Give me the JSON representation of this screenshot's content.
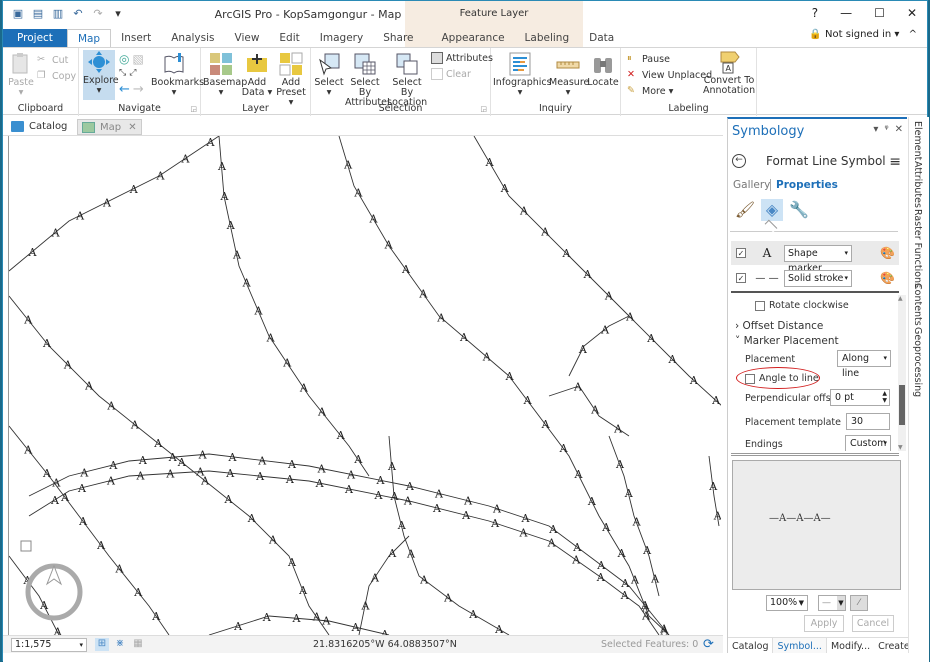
{
  "window": {
    "title": "ArcGIS Pro - KopSamgongur - Map",
    "context_tab_group": "Feature Layer",
    "help_label": "?",
    "minimize_label": "—",
    "maximize_label": "☐",
    "close_label": "✕",
    "sign_in_label": "Not signed in ▾",
    "collapse_ribbon_label": "^"
  },
  "quick_access": {
    "undo_label": "↶",
    "redo_label": "↷",
    "customize_label": "▾"
  },
  "ribbon_tabs": [
    {
      "label": "Project"
    },
    {
      "label": "Map"
    },
    {
      "label": "Insert"
    },
    {
      "label": "Analysis"
    },
    {
      "label": "View"
    },
    {
      "label": "Edit"
    },
    {
      "label": "Imagery"
    },
    {
      "label": "Share"
    },
    {
      "label": "Appearance"
    },
    {
      "label": "Labeling"
    },
    {
      "label": "Data"
    }
  ],
  "ribbon": {
    "clipboard": {
      "label": "Clipboard",
      "paste": "Paste",
      "cut": "Cut",
      "copy": "Copy"
    },
    "navigate": {
      "label": "Navigate",
      "explore": "Explore",
      "bookmarks": "Bookmarks"
    },
    "layer": {
      "label": "Layer",
      "basemap": "Basemap",
      "add_data_1": "Add",
      "add_data_2": "Data ▾",
      "add_preset_1": "Add",
      "add_preset_2": "Preset ▾"
    },
    "selection": {
      "label": "Selection",
      "select": "Select",
      "select_by_attributes_1": "Select By",
      "select_by_attributes_2": "Attributes",
      "select_by_location_1": "Select By",
      "select_by_location_2": "Location",
      "attributes": "Attributes",
      "clear": "Clear"
    },
    "inquiry": {
      "label": "Inquiry",
      "infographics": "Infographics",
      "measure": "Measure",
      "locate": "Locate"
    },
    "labeling": {
      "label": "Labeling",
      "pause": "Pause",
      "view_unplaced": "View Unplaced",
      "more": "More ▾",
      "convert_1": "Convert To",
      "convert_2": "Annotation"
    }
  },
  "doc_tabs": [
    {
      "label": "Catalog"
    },
    {
      "label": "Map",
      "close": "✕"
    }
  ],
  "map": {
    "marker_glyph": "A"
  },
  "status_bar": {
    "scale": "1:1,575",
    "coordinates": "21.8316205°W 64.0883507°N",
    "selected_features": "Selected Features: 0"
  },
  "symbology": {
    "title": "Symbology",
    "pane_controls": [
      "▾",
      "ᵠ",
      "✕"
    ],
    "format_title": "Format Line Symbol",
    "gallery_tab": "Gallery",
    "properties_tab": "Properties",
    "layers": [
      {
        "checked": true,
        "symbol": "A",
        "type": "Shape marker"
      },
      {
        "checked": true,
        "symbol": "— —",
        "type": "Solid stroke"
      }
    ],
    "rotate_clockwise": {
      "label": "Rotate clockwise",
      "checked": false
    },
    "offset_distance": "Offset Distance",
    "marker_placement": "Marker Placement",
    "placement": {
      "label": "Placement",
      "value": "Along line"
    },
    "angle_to_line": {
      "label": "Angle to line",
      "checked": false
    },
    "perpendicular_offset": {
      "label": "Perpendicular offset",
      "value": "0 pt"
    },
    "placement_template": {
      "label": "Placement template",
      "value": "30"
    },
    "endings": {
      "label": "Endings",
      "value": "Custom"
    },
    "preview_symbol": "—A—A—A—",
    "preview_zoom": "100%",
    "apply": "Apply",
    "cancel": "Cancel",
    "bottom_tabs": [
      {
        "label": "Catalog"
      },
      {
        "label": "Symbol..."
      },
      {
        "label": "Modify..."
      },
      {
        "label": "Create..."
      }
    ]
  },
  "side_tabs": [
    {
      "label": "Element"
    },
    {
      "label": "Attributes"
    },
    {
      "label": "Raster Functions"
    },
    {
      "label": "Contents"
    },
    {
      "label": "Geoprocessing"
    }
  ],
  "colors": {
    "accent": "#1d6fb8",
    "context_tab_bg": "#f6ece1",
    "annotation_oval": "#d21f1f"
  }
}
